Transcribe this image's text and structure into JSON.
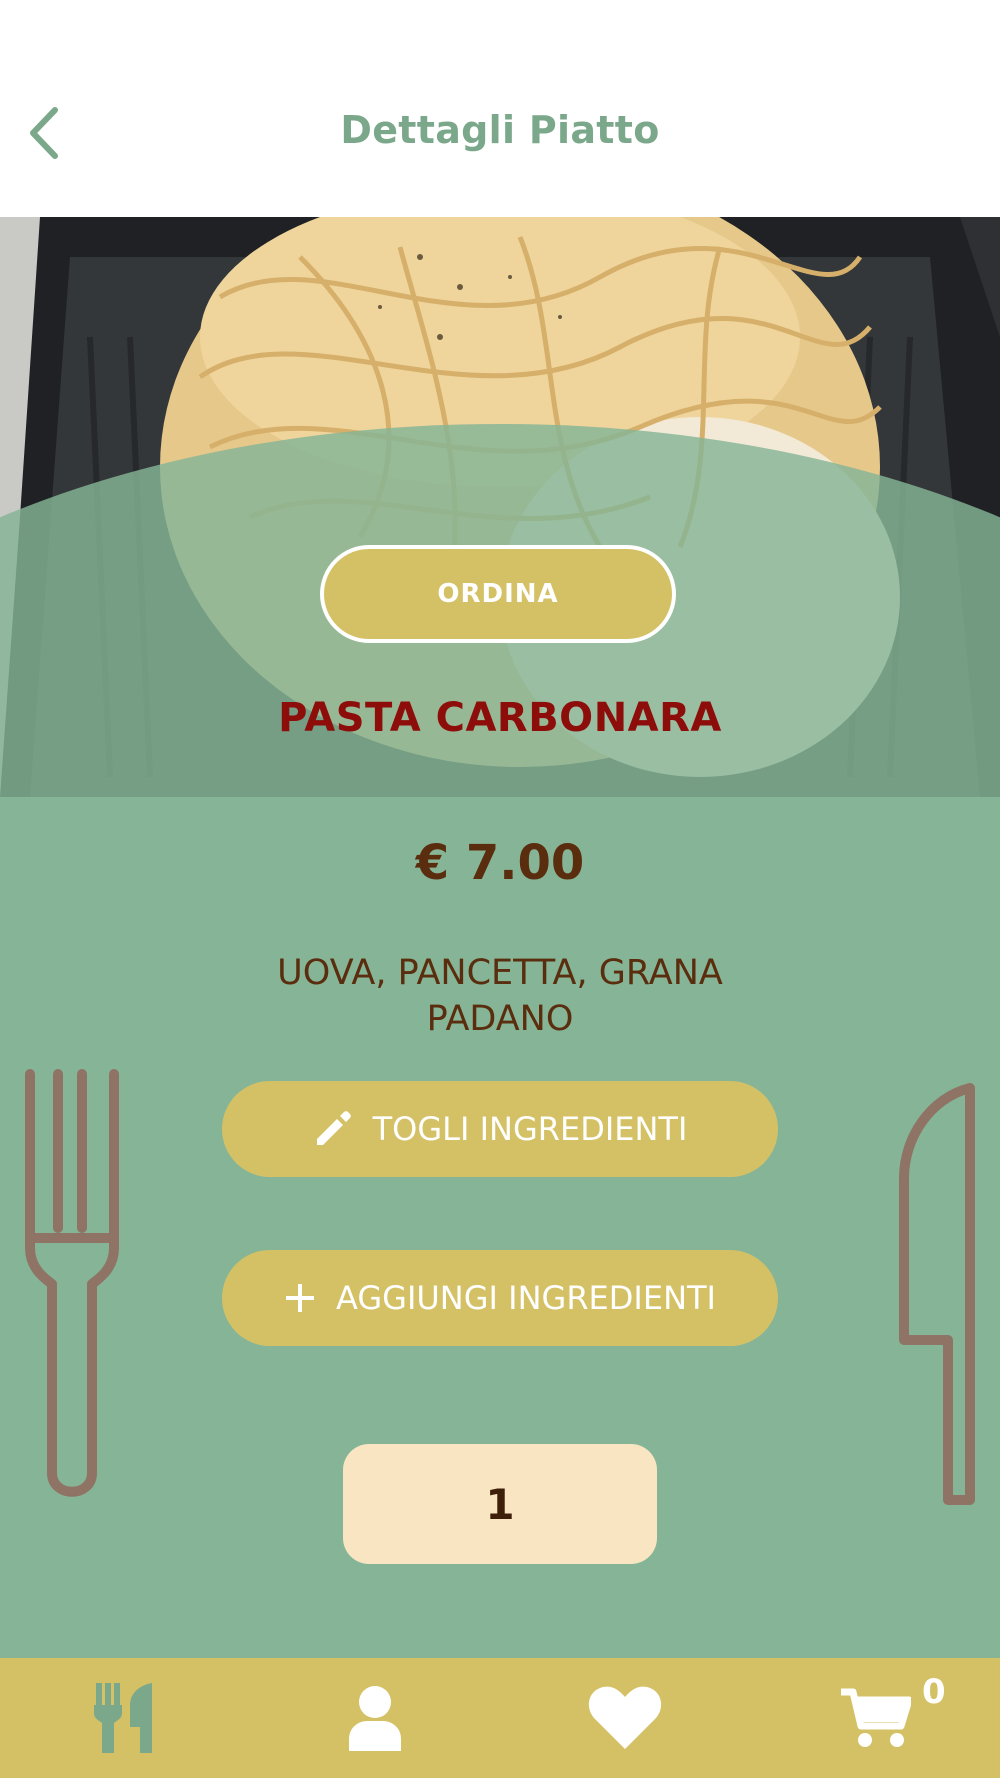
{
  "header": {
    "title": "Dettagli Piatto",
    "back_icon": "chevron-left-icon"
  },
  "dish": {
    "order_button_label": "ORDINA",
    "name": "PASTA CARBONARA",
    "price": "€ 7.00",
    "ingredients": "UOVA, PANCETTA, GRANA PADANO",
    "remove_ingredients_label": "TOGLI INGREDIENTI",
    "add_ingredients_label": "AGGIUNGI INGREDIENTI",
    "quantity": "1"
  },
  "tabbar": {
    "tabs": [
      {
        "icon": "utensils-icon"
      },
      {
        "icon": "user-icon"
      },
      {
        "icon": "heart-icon"
      },
      {
        "icon": "cart-icon"
      }
    ],
    "cart_count": "0"
  },
  "colors": {
    "accent_green": "#85b596",
    "title_green": "#7ba88b",
    "gold": "#d5c165",
    "dish_red": "#8c0d0a",
    "brown_text": "#5a2d0e",
    "quantity_bg": "#f9e5c2",
    "cutlery": "#8f7465"
  }
}
